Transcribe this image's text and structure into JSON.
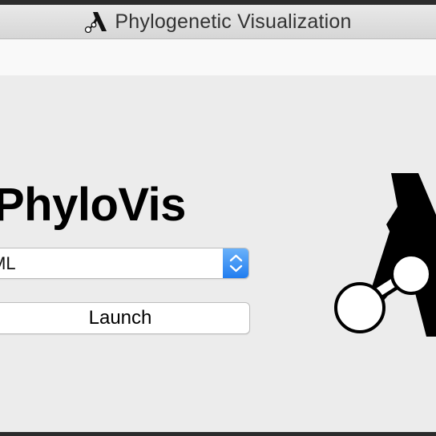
{
  "window": {
    "title": "Phylogenetic Visualization",
    "icon": "phylovis-lambda-logo-icon"
  },
  "app": {
    "title": "PhyloVis",
    "logo": "phylovis-lambda-logo"
  },
  "form": {
    "format_select": {
      "value": "ML",
      "icon": "up-down-chevron-icon"
    },
    "launch_label": "Launch"
  },
  "colors": {
    "accent": "#1e7bef",
    "window_background": "#ececec"
  }
}
